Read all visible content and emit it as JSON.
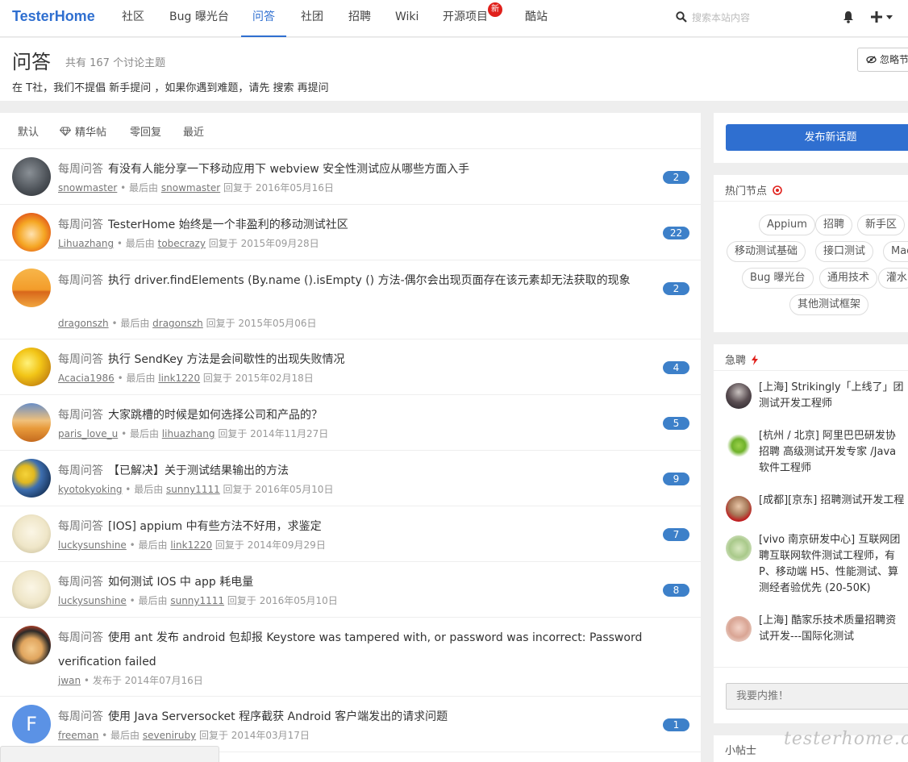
{
  "navbar": {
    "brand": "TesterHome",
    "items": [
      {
        "label": "社区"
      },
      {
        "label": "Bug 曝光台"
      },
      {
        "label": "问答"
      },
      {
        "label": "社团"
      },
      {
        "label": "招聘"
      },
      {
        "label": "Wiki"
      },
      {
        "label": "开源项目",
        "badge": "新"
      },
      {
        "label": "酷站"
      }
    ],
    "search_placeholder": "搜索本站内容",
    "accent": "#2f6fd0"
  },
  "header": {
    "title": "问答",
    "count_text": "共有 167 个讨论主题",
    "desc": "在 T社，我们不提倡 新手提问 ，如果你遇到难题，请先 搜索 再提问",
    "ignore_label": "忽略节"
  },
  "filters": [
    "默认",
    "精华帖",
    "零回复",
    "最近"
  ],
  "topics": [
    {
      "node": "每周问答",
      "title": "有没有人能分享一下移动应用下 webview 安全性测试应从哪些方面入手",
      "author": "snowmaster",
      "sep": " • 最后由 ",
      "last": "snowmaster",
      "time": " 回复于 2016年05月16日",
      "count": "2"
    },
    {
      "node": "每周问答",
      "title": "TesterHome 始终是一个非盈利的移动测试社区",
      "author": "Lihuazhang",
      "sep": " • 最后由 ",
      "last": "tobecrazy",
      "time": " 回复于 2015年09月28日",
      "count": "22"
    },
    {
      "node": "每周问答",
      "title": "执行 driver.findElements (By.name ().isEmpty () 方法-偶尔会出现页面存在该元素却无法获取的现象",
      "author": "dragonszh",
      "sep": " • 最后由 ",
      "last": "dragonszh",
      "time": " 回复于 2015年05月06日",
      "count": "2"
    },
    {
      "node": "每周问答",
      "title": "执行 SendKey 方法是会间歇性的出现失败情况",
      "author": "Acacia1986",
      "sep": " • 最后由 ",
      "last": "link1220",
      "time": " 回复于 2015年02月18日",
      "count": "4"
    },
    {
      "node": "每周问答",
      "title": "大家跳槽的时候是如何选择公司和产品的？",
      "author": "paris_love_u",
      "sep": " • 最后由 ",
      "last": "lihuazhang",
      "time": " 回复于 2014年11月27日",
      "count": "5"
    },
    {
      "node": "每周问答",
      "title": "【已解决】关于测试结果输出的方法",
      "author": "kyotokyoking",
      "sep": " • 最后由 ",
      "last": "sunny1111",
      "time": " 回复于 2016年05月10日",
      "count": "9"
    },
    {
      "node": "每周问答",
      "title": "[IOS] appium 中有些方法不好用，求鉴定",
      "author": "luckysunshine",
      "sep": " • 最后由 ",
      "last": "link1220",
      "time": " 回复于 2014年09月29日",
      "count": "7"
    },
    {
      "node": "每周问答",
      "title": "如何测试 IOS 中 app 耗电量",
      "author": "luckysunshine",
      "sep": " • 最后由 ",
      "last": "sunny1111",
      "time": " 回复于 2016年05月10日",
      "count": "8"
    },
    {
      "node": "每周问答",
      "title": "使用 ant 发布 android 包却报 Keystore was tampered with, or password was incorrect: Password verification failed",
      "author": "jwan",
      "sep": " • 发布于 2014年07月16日",
      "last": "",
      "time": "",
      "count": ""
    },
    {
      "node": "每周问答",
      "title": "使用 Java Serversocket 程序截获 Android 客户端发出的请求问题",
      "author": "freeman",
      "sep": " • 最后由 ",
      "last": "seveniruby",
      "time": " 回复于 2014年03月17日",
      "count": "1",
      "avatar_letter": "F"
    }
  ],
  "sidebar": {
    "new_topic": "发布新话题",
    "hot_nodes_title": "热门节点",
    "nodes": [
      "Appium",
      "招聘",
      "新手区",
      "移动测试基础",
      "接口测试",
      "Mac",
      "Bug 曝光台",
      "通用技术",
      "灌水",
      "其他测试框架"
    ],
    "jobs_title": "急聘",
    "jobs": [
      "[上海] Strikingly「上线了」团\n测试开发工程师",
      "[杭州 / 北京] 阿里巴巴研发协\n招聘 高级测试开发专家 /Java\n软件工程师",
      "[成都][京东] 招聘测试开发工程",
      "[vivo 南京研发中心] 互联网团\n聘互联网软件测试工程师，有\nP、移动端 H5、性能测试、算\n测经者验优先 (20-50K)",
      "[上海] 酷家乐技术质量招聘资\n试开发---国际化测试"
    ],
    "referral_placeholder": "我要内推！",
    "tips_title": "小帖士"
  },
  "watermark": "testerhome.com"
}
